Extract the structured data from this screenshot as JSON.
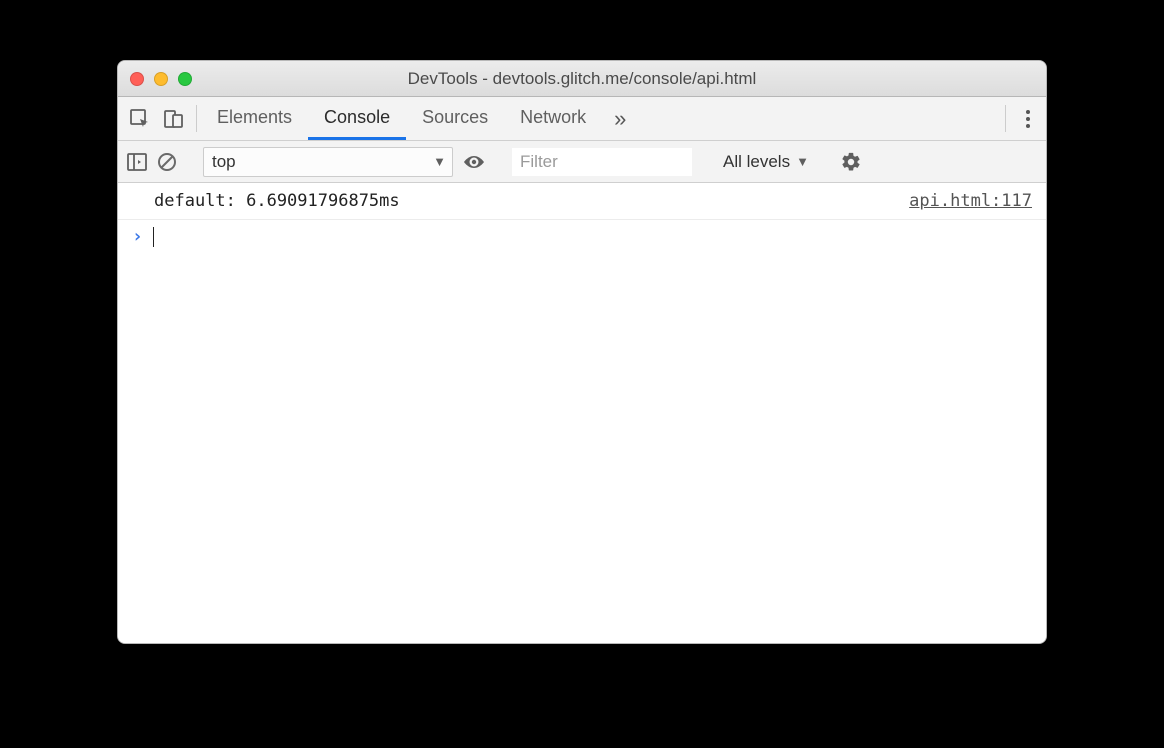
{
  "window": {
    "title": "DevTools - devtools.glitch.me/console/api.html"
  },
  "tabs": {
    "items": [
      "Elements",
      "Console",
      "Sources",
      "Network"
    ],
    "active_index": 1,
    "overflow_glyph": "»"
  },
  "toolbar": {
    "context": "top",
    "filter_placeholder": "Filter",
    "levels_label": "All levels"
  },
  "console": {
    "entries": [
      {
        "message": "default: 6.69091796875ms",
        "source": "api.html:117"
      }
    ],
    "prompt_glyph": "›"
  }
}
